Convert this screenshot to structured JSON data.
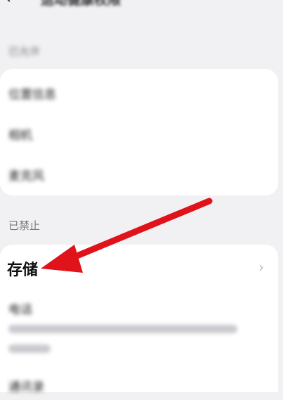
{
  "header": {
    "back_icon": "arrow-left-icon",
    "title": "运动健康权限"
  },
  "allowed_section": {
    "label": "已允许",
    "items": [
      {
        "label": "位置信息"
      },
      {
        "label": "相机"
      },
      {
        "label": "麦克风"
      }
    ]
  },
  "forbidden_section": {
    "label": "已禁止",
    "items": [
      {
        "label": "存储",
        "chevron": "›"
      },
      {
        "label": "电话"
      },
      {
        "label": "通讯录"
      }
    ]
  },
  "colors": {
    "background": "#f1f1f3",
    "card": "#ffffff",
    "arrow": "#e0121a"
  }
}
